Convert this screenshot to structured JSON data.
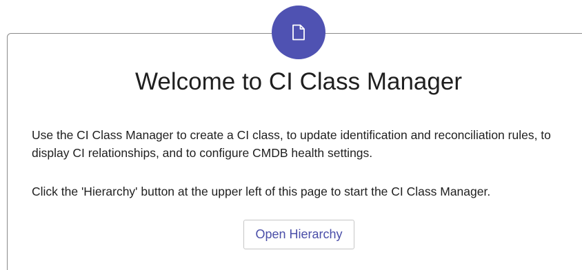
{
  "badge": {
    "icon": "document-icon",
    "color": "#4f52b2"
  },
  "welcome": {
    "title": "Welcome to CI Class Manager",
    "description": "Use the CI Class Manager to create a CI class, to update identification and reconciliation rules, to display CI relationships, and to configure CMDB health settings.",
    "hint": "Click the 'Hierarchy' button at the upper left of this page to start the CI Class Manager."
  },
  "actions": {
    "open_hierarchy_label": "Open Hierarchy"
  }
}
